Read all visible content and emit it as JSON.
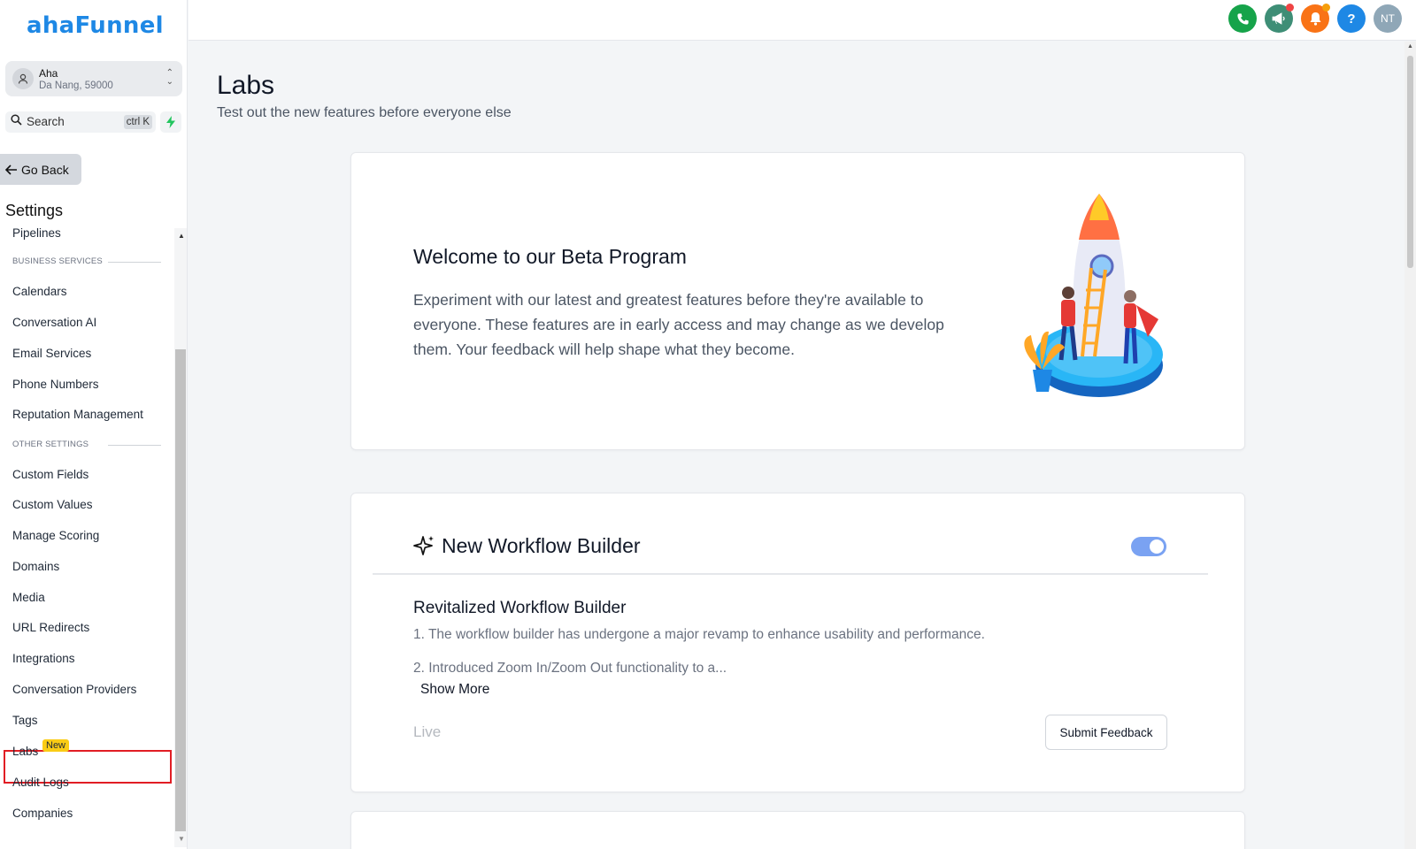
{
  "brand": {
    "logo_text": "ahaFunnel",
    "color": "#1e88e5"
  },
  "account": {
    "name": "Aha",
    "location": "Da Nang, 59000"
  },
  "search": {
    "label": "Search",
    "shortcut": "ctrl K"
  },
  "sidebar": {
    "go_back": "Go Back",
    "settings_title": "Settings",
    "items": [
      {
        "label": "Pipelines",
        "type": "item"
      },
      {
        "label": "BUSINESS SERVICES",
        "type": "section"
      },
      {
        "label": "Calendars",
        "type": "item"
      },
      {
        "label": "Conversation AI",
        "type": "item"
      },
      {
        "label": "Email Services",
        "type": "item"
      },
      {
        "label": "Phone Numbers",
        "type": "item"
      },
      {
        "label": "Reputation Management",
        "type": "item"
      },
      {
        "label": "OTHER SETTINGS",
        "type": "section"
      },
      {
        "label": "Custom Fields",
        "type": "item"
      },
      {
        "label": "Custom Values",
        "type": "item"
      },
      {
        "label": "Manage Scoring",
        "type": "item"
      },
      {
        "label": "Domains",
        "type": "item"
      },
      {
        "label": "Media",
        "type": "item"
      },
      {
        "label": "URL Redirects",
        "type": "item"
      },
      {
        "label": "Integrations",
        "type": "item"
      },
      {
        "label": "Conversation Providers",
        "type": "item"
      },
      {
        "label": "Tags",
        "type": "item"
      },
      {
        "label": "Labs",
        "type": "item",
        "badge": "New",
        "selected": true
      },
      {
        "label": "Audit Logs",
        "type": "item"
      },
      {
        "label": "Companies",
        "type": "item"
      }
    ]
  },
  "topbar": {
    "avatar_initials": "NT",
    "buttons": [
      {
        "icon": "phone-icon",
        "color": "#16a34a"
      },
      {
        "icon": "megaphone-icon",
        "color": "#3e8e76",
        "dot": "#ef4444"
      },
      {
        "icon": "bell-icon",
        "color": "#f97316",
        "dot": "#f59e0b"
      },
      {
        "icon": "help-icon",
        "color": "#1e88e5",
        "symbol": "?"
      }
    ],
    "avatar_color": "#8fa7b7"
  },
  "page": {
    "title": "Labs",
    "subtitle": "Test out the new features before everyone else"
  },
  "welcome": {
    "title": "Welcome to our Beta Program",
    "text": "Experiment with our latest and greatest features before they're available to everyone. These features are in early access and may change as we develop them. Your feedback will help shape what they become."
  },
  "feature": {
    "title": "New Workflow Builder",
    "enabled": true,
    "subtitle": "Revitalized Workflow Builder",
    "line1": "1. The workflow builder has undergone a major revamp to enhance usability and performance.",
    "line2": "2. Introduced Zoom In/Zoom Out functionality to a...",
    "show_more": "Show More",
    "status": "Live",
    "feedback_button": "Submit Feedback"
  }
}
